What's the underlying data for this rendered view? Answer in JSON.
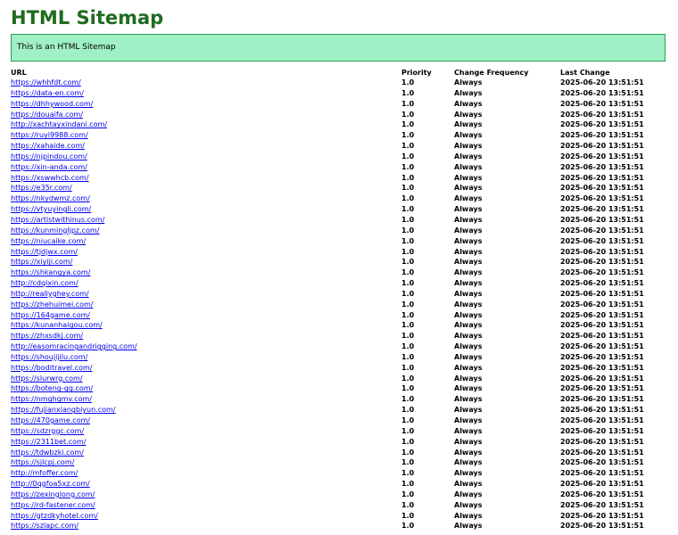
{
  "title": "HTML Sitemap",
  "notice": "This is an HTML Sitemap",
  "columns": [
    "URL",
    "Priority",
    "Change Frequency",
    "Last Change"
  ],
  "rows": [
    {
      "url": "https://whhfdt.com/",
      "priority": "1.0",
      "freq": "Always",
      "date": "2025-06-20 13:51:51"
    },
    {
      "url": "https://data-en.com/",
      "priority": "1.0",
      "freq": "Always",
      "date": "2025-06-20 13:51:51"
    },
    {
      "url": "https://dhhywood.com/",
      "priority": "1.0",
      "freq": "Always",
      "date": "2025-06-20 13:51:51"
    },
    {
      "url": "https://douaifa.com/",
      "priority": "1.0",
      "freq": "Always",
      "date": "2025-06-20 13:51:51"
    },
    {
      "url": "http://xachtayxindani.com/",
      "priority": "1.0",
      "freq": "Always",
      "date": "2025-06-20 13:51:51"
    },
    {
      "url": "https://ruyi9988.com/",
      "priority": "1.0",
      "freq": "Always",
      "date": "2025-06-20 13:51:51"
    },
    {
      "url": "https://xahaide.com/",
      "priority": "1.0",
      "freq": "Always",
      "date": "2025-06-20 13:51:51"
    },
    {
      "url": "https://njpindou.com/",
      "priority": "1.0",
      "freq": "Always",
      "date": "2025-06-20 13:51:51"
    },
    {
      "url": "https://xin-anda.com/",
      "priority": "1.0",
      "freq": "Always",
      "date": "2025-06-20 13:51:51"
    },
    {
      "url": "https://xswwhcb.com/",
      "priority": "1.0",
      "freq": "Always",
      "date": "2025-06-20 13:51:51"
    },
    {
      "url": "https://e35r.com/",
      "priority": "1.0",
      "freq": "Always",
      "date": "2025-06-20 13:51:51"
    },
    {
      "url": "https://nkydwmz.com/",
      "priority": "1.0",
      "freq": "Always",
      "date": "2025-06-20 13:51:51"
    },
    {
      "url": "https://vtyuyingli.com/",
      "priority": "1.0",
      "freq": "Always",
      "date": "2025-06-20 13:51:51"
    },
    {
      "url": "https://artistwithinus.com/",
      "priority": "1.0",
      "freq": "Always",
      "date": "2025-06-20 13:51:51"
    },
    {
      "url": "https://kunmingljpz.com/",
      "priority": "1.0",
      "freq": "Always",
      "date": "2025-06-20 13:51:51"
    },
    {
      "url": "https://niucaike.com/",
      "priority": "1.0",
      "freq": "Always",
      "date": "2025-06-20 13:51:51"
    },
    {
      "url": "https://tjdjwx.com/",
      "priority": "1.0",
      "freq": "Always",
      "date": "2025-06-20 13:51:51"
    },
    {
      "url": "https://xiyiji.com/",
      "priority": "1.0",
      "freq": "Always",
      "date": "2025-06-20 13:51:51"
    },
    {
      "url": "https://shkangya.com/",
      "priority": "1.0",
      "freq": "Always",
      "date": "2025-06-20 13:51:51"
    },
    {
      "url": "http://cdqixin.com/",
      "priority": "1.0",
      "freq": "Always",
      "date": "2025-06-20 13:51:51"
    },
    {
      "url": "http://reallyghey.com/",
      "priority": "1.0",
      "freq": "Always",
      "date": "2025-06-20 13:51:51"
    },
    {
      "url": "https://zhehuimei.com/",
      "priority": "1.0",
      "freq": "Always",
      "date": "2025-06-20 13:51:51"
    },
    {
      "url": "https://164game.com/",
      "priority": "1.0",
      "freq": "Always",
      "date": "2025-06-20 13:51:51"
    },
    {
      "url": "https://kunanhaigou.com/",
      "priority": "1.0",
      "freq": "Always",
      "date": "2025-06-20 13:51:51"
    },
    {
      "url": "https://zhxsdkj.com/",
      "priority": "1.0",
      "freq": "Always",
      "date": "2025-06-20 13:51:51"
    },
    {
      "url": "http://easomracingandrigging.com/",
      "priority": "1.0",
      "freq": "Always",
      "date": "2025-06-20 13:51:51"
    },
    {
      "url": "https://shoujijilu.com/",
      "priority": "1.0",
      "freq": "Always",
      "date": "2025-06-20 13:51:51"
    },
    {
      "url": "https://boditravel.com/",
      "priority": "1.0",
      "freq": "Always",
      "date": "2025-06-20 13:51:51"
    },
    {
      "url": "https://slurwrg.com/",
      "priority": "1.0",
      "freq": "Always",
      "date": "2025-06-20 13:51:51"
    },
    {
      "url": "https://boteng-gg.com/",
      "priority": "1.0",
      "freq": "Always",
      "date": "2025-06-20 13:51:51"
    },
    {
      "url": "https://nmghgmv.com/",
      "priority": "1.0",
      "freq": "Always",
      "date": "2025-06-20 13:51:51"
    },
    {
      "url": "https://fujianxiangbiyun.com/",
      "priority": "1.0",
      "freq": "Always",
      "date": "2025-06-20 13:51:51"
    },
    {
      "url": "https://470game.com/",
      "priority": "1.0",
      "freq": "Always",
      "date": "2025-06-20 13:51:51"
    },
    {
      "url": "https://sdzrggc.com/",
      "priority": "1.0",
      "freq": "Always",
      "date": "2025-06-20 13:51:51"
    },
    {
      "url": "https://2311bet.com/",
      "priority": "1.0",
      "freq": "Always",
      "date": "2025-06-20 13:51:51"
    },
    {
      "url": "https://tdwbzki.com/",
      "priority": "1.0",
      "freq": "Always",
      "date": "2025-06-20 13:51:51"
    },
    {
      "url": "https://sjlcpj.com/",
      "priority": "1.0",
      "freq": "Always",
      "date": "2025-06-20 13:51:51"
    },
    {
      "url": "http://mfoffer.com/",
      "priority": "1.0",
      "freq": "Always",
      "date": "2025-06-20 13:51:51"
    },
    {
      "url": "http://0qgfoa5xz.com/",
      "priority": "1.0",
      "freq": "Always",
      "date": "2025-06-20 13:51:51"
    },
    {
      "url": "https://zexinglong.com/",
      "priority": "1.0",
      "freq": "Always",
      "date": "2025-06-20 13:51:51"
    },
    {
      "url": "https://rd-fastener.com/",
      "priority": "1.0",
      "freq": "Always",
      "date": "2025-06-20 13:51:51"
    },
    {
      "url": "https://gtzdkyhotel.com/",
      "priority": "1.0",
      "freq": "Always",
      "date": "2025-06-20 13:51:51"
    },
    {
      "url": "https://szlapc.com/",
      "priority": "1.0",
      "freq": "Always",
      "date": "2025-06-20 13:51:51"
    }
  ]
}
